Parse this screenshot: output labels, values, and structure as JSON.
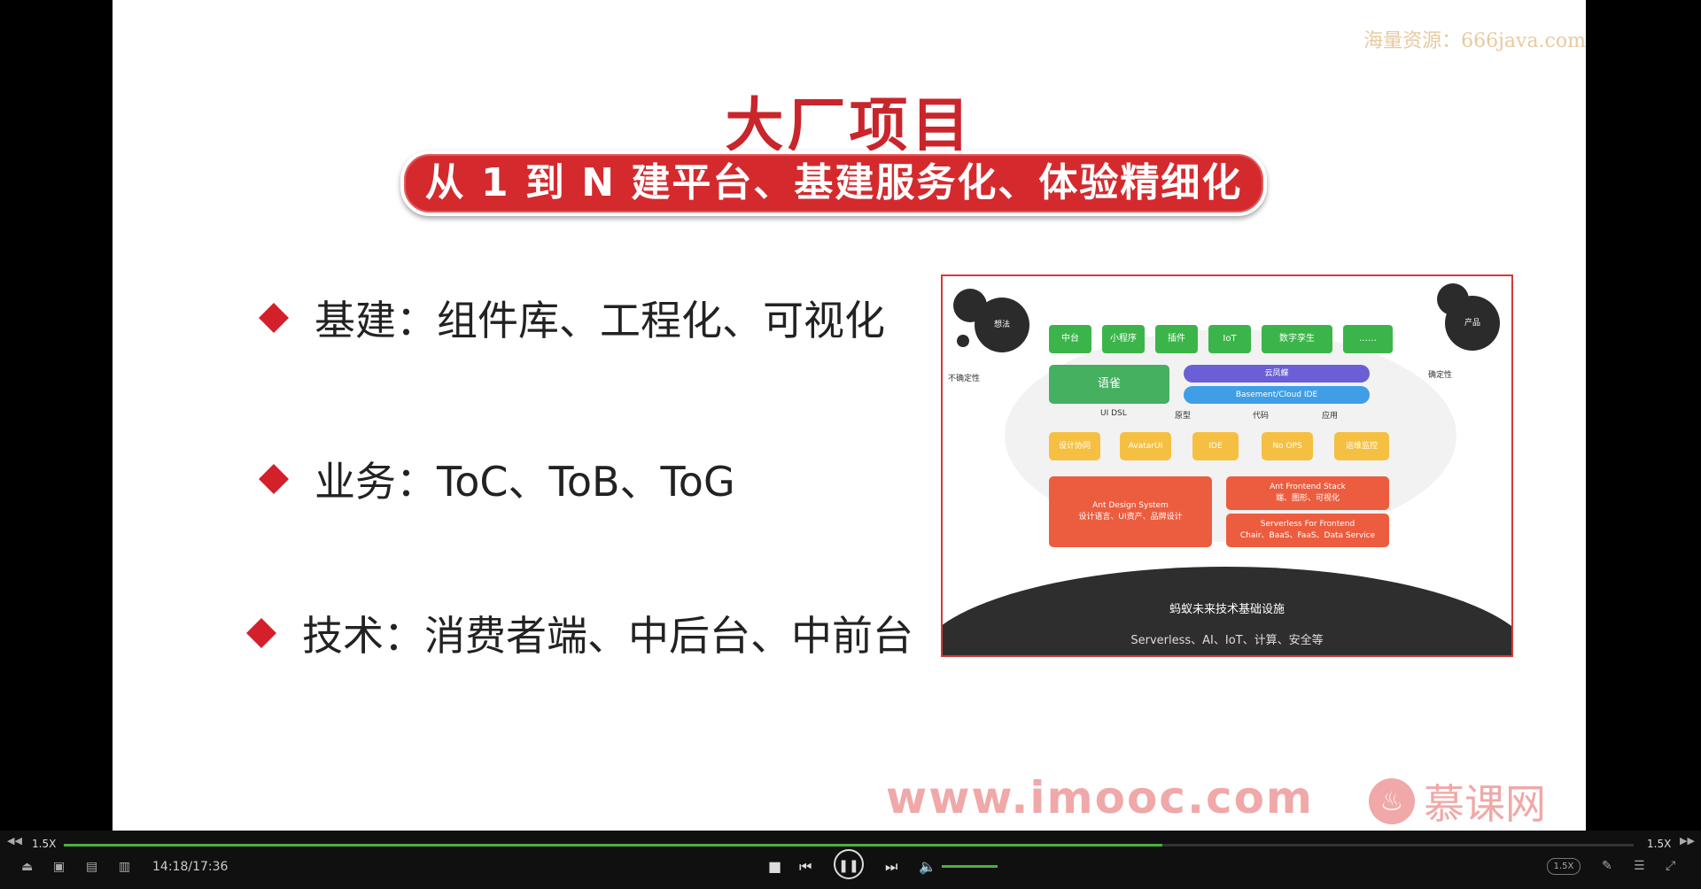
{
  "slide": {
    "watermark": "海量资源：666java.com",
    "title": "大厂项目",
    "subtitle": "从 1 到 N 建平台、基建服务化、体验精细化",
    "bullets": [
      "基建：组件库、工程化、可视化",
      "业务：ToC、ToB、ToG",
      "技术：消费者端、中后台、中前台"
    ],
    "footer_url": "www.imooc.com",
    "footer_brand": "慕课网"
  },
  "diagram": {
    "left_bubble": "想法",
    "right_bubble": "产品",
    "left_caption": "不确定性",
    "right_caption": "确定性",
    "green_boxes": [
      "中台",
      "小程序",
      "插件",
      "IoT",
      "数字孪生",
      "……"
    ],
    "yuque": "语雀",
    "purple_top": "云凤蝶",
    "blue_bar": "Basement/Cloud IDE",
    "row_labels": [
      "UI DSL",
      "原型",
      "代码",
      "应用"
    ],
    "yellow_boxes": [
      "设计协同",
      "AvatarUI",
      "IDE",
      "No OPS",
      "运维监控"
    ],
    "orange_left_title": "Ant Design System",
    "orange_left_sub": "设计语言、UI资产、品牌设计",
    "orange_right_top_title": "Ant Frontend Stack",
    "orange_right_top_sub": "端、图形、可视化",
    "orange_right_bottom_title": "Serverless For Frontend",
    "orange_right_bottom_sub": "Chair、BaaS、FaaS、Data Service",
    "dome_title": "蚂蚁未来技术基础设施",
    "dome_subtitle": "Serverless、AI、IoT、计算、安全等"
  },
  "player": {
    "speed_left": "1.5X",
    "speed_right": "1.5X",
    "time": "14:18/17:36",
    "progress": 0.7,
    "volume": 1.0,
    "speed_pill": "1.5X"
  }
}
